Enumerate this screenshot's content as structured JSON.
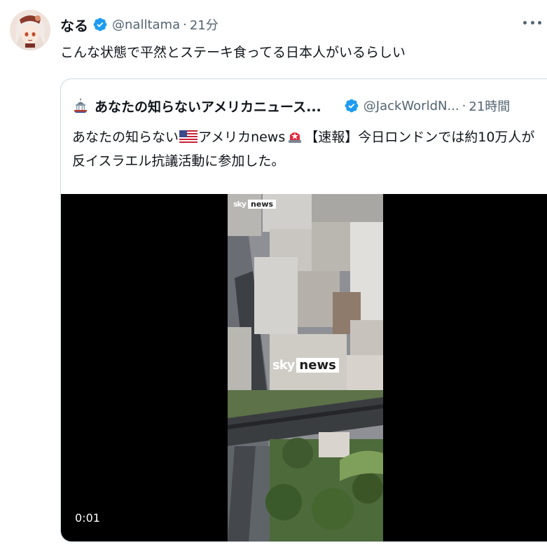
{
  "tweet": {
    "author_name": "なる",
    "handle": "@nalltama",
    "separator": "·",
    "time": "21分",
    "text": "こんな状態で平然とステーキ食ってる日本人がいるらしい"
  },
  "quoted": {
    "author_name": "あなたの知らないアメリカニュース...",
    "handle": "@JackWorldN...",
    "separator": "·",
    "time": "21時間",
    "text_part1": "あなたの知らない",
    "text_part2": "アメリカnews",
    "text_part3": "【速報】今日ロンドンでは約10万人が反イスラエル抗議活動に参加した。",
    "flag_icons": [
      "us-flag-icon",
      "siren-icon"
    ]
  },
  "video": {
    "watermark_sky": "sky",
    "watermark_news": "news",
    "timecode": "0:01"
  },
  "colors": {
    "verified": "#1d9bf0",
    "secondary_text": "#536471",
    "border": "#cfd9de"
  }
}
